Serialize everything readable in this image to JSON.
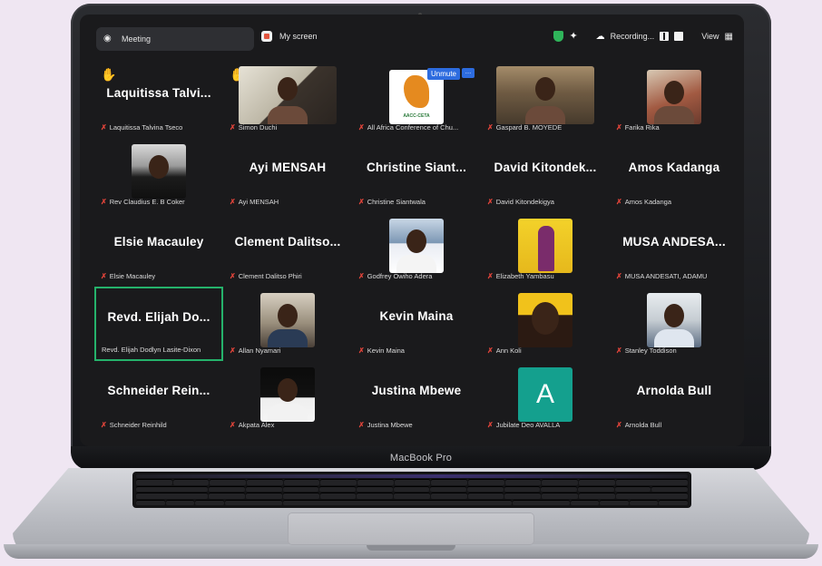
{
  "device": {
    "chin_label": "MacBook Pro"
  },
  "topbar": {
    "meeting_tab": "Meeting",
    "screen_tab": "My screen",
    "recording": "Recording...",
    "view": "View"
  },
  "tile_controls": {
    "unmute": "Unmute",
    "more": "…"
  },
  "participants": [
    {
      "name": "Laquitissa  Talvi...",
      "label": "Laquitissa Talvina Tseco"
    },
    {
      "name": "",
      "label": "Simon Duchi"
    },
    {
      "name": "",
      "label": "All Africa Conference of Chu..."
    },
    {
      "name": "",
      "label": "Gaspard B. MOYEDE"
    },
    {
      "name": "",
      "label": "Farika Rika"
    },
    {
      "name": "",
      "label": "Rev Claudius E. B Coker"
    },
    {
      "name": "Ayi  MENSAH",
      "label": "Ayi MENSAH"
    },
    {
      "name": "Christine  Siant...",
      "label": "Christine Siantwala"
    },
    {
      "name": "David  Kitondek...",
      "label": "David Kitondekigya"
    },
    {
      "name": "Amos  Kadanga",
      "label": "Amos Kadanga"
    },
    {
      "name": "Elsie  Macauley",
      "label": "Elsie Macauley"
    },
    {
      "name": "Clement  Dalitso...",
      "label": "Clement Dalitso Phiri"
    },
    {
      "name": "",
      "label": "Godfrey Owiho Adera"
    },
    {
      "name": "",
      "label": "Elizabeth Yambasu"
    },
    {
      "name": "MUSA  ANDESA...",
      "label": "MUSA ANDESATI, ADAMU"
    },
    {
      "name": "Revd.  Elijah  Do...",
      "label": "Revd. Elijah Dodlyn Lasite-Dixon"
    },
    {
      "name": "",
      "label": "Allan Nyamari"
    },
    {
      "name": "Kevin  Maina",
      "label": "Kevin Maina"
    },
    {
      "name": "",
      "label": "Ann Koli"
    },
    {
      "name": "",
      "label": "Stanley Toddison"
    },
    {
      "name": "Schneider  Rein...",
      "label": "Schneider Reinhild"
    },
    {
      "name": "",
      "label": "Akpata Alex"
    },
    {
      "name": "Justina  Mbewe",
      "label": "Justina Mbewe"
    },
    {
      "name": "",
      "label": "Jubilate Deo AVALLA",
      "avatar_letter": "A"
    },
    {
      "name": "Arnolda  Bull",
      "label": "Arnolda Bull"
    }
  ],
  "logo_caption": "AACC-CETA",
  "colors": {
    "active_border": "#25b26b",
    "mic_muted": "#e0443a",
    "hand": "#f6c12b",
    "unmute_btn": "#2d6cdf"
  }
}
